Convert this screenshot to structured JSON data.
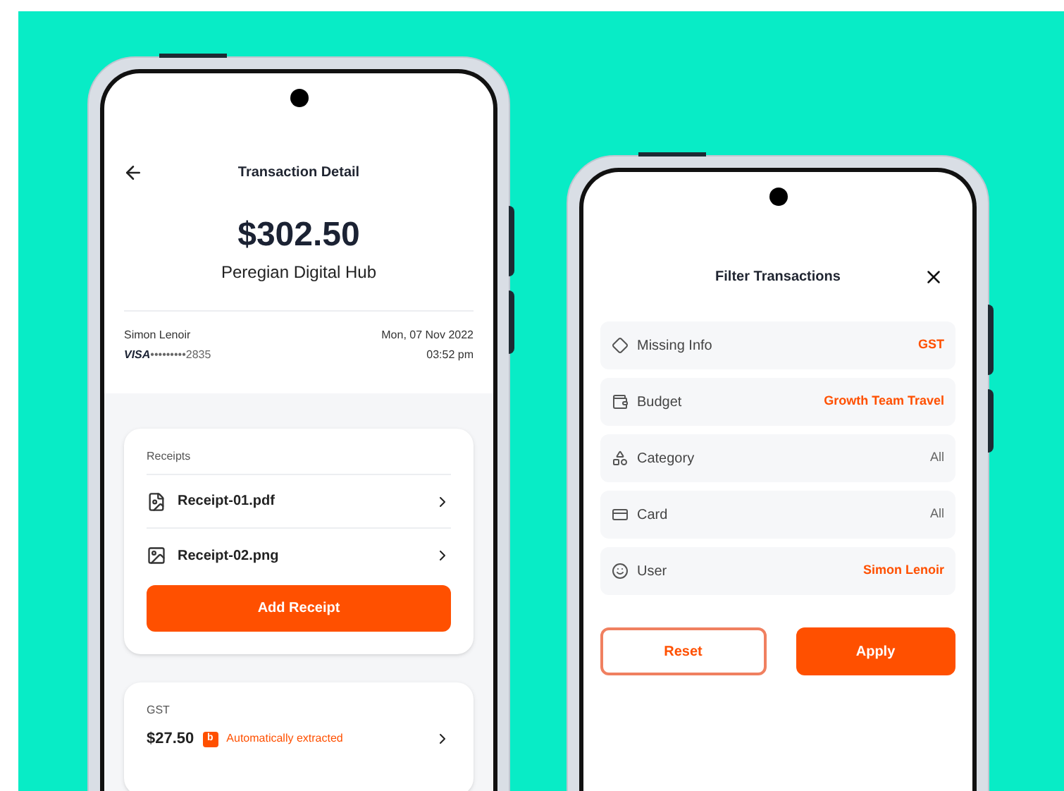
{
  "transaction_screen": {
    "title": "Transaction Detail",
    "amount": "$302.50",
    "merchant": "Peregian Digital Hub",
    "cardholder": "Simon Lenoir",
    "card_brand": "VISA",
    "card_number": "•••••••••2835",
    "date": "Mon, 07 Nov 2022",
    "time": "03:52 pm",
    "receipts": {
      "label": "Receipts",
      "items": [
        {
          "name": "Receipt-01.pdf"
        },
        {
          "name": "Receipt-02.png"
        }
      ],
      "button": "Add Receipt"
    },
    "tax": {
      "label": "GST",
      "amount": "$27.50",
      "badge_icon": "b",
      "badge": "Automatically extracted"
    }
  },
  "filter_screen": {
    "title": "Filter Transactions",
    "filters": [
      {
        "label": "Missing Info",
        "value": "GST",
        "active": true
      },
      {
        "label": "Budget",
        "value": "Growth Team Travel",
        "active": true
      },
      {
        "label": "Category",
        "value": "All",
        "active": false
      },
      {
        "label": "Card",
        "value": "All",
        "active": false
      },
      {
        "label": "User",
        "value": "Simon Lenoir",
        "active": true
      }
    ],
    "buttons": {
      "reset": "Reset",
      "apply": "Apply"
    }
  }
}
